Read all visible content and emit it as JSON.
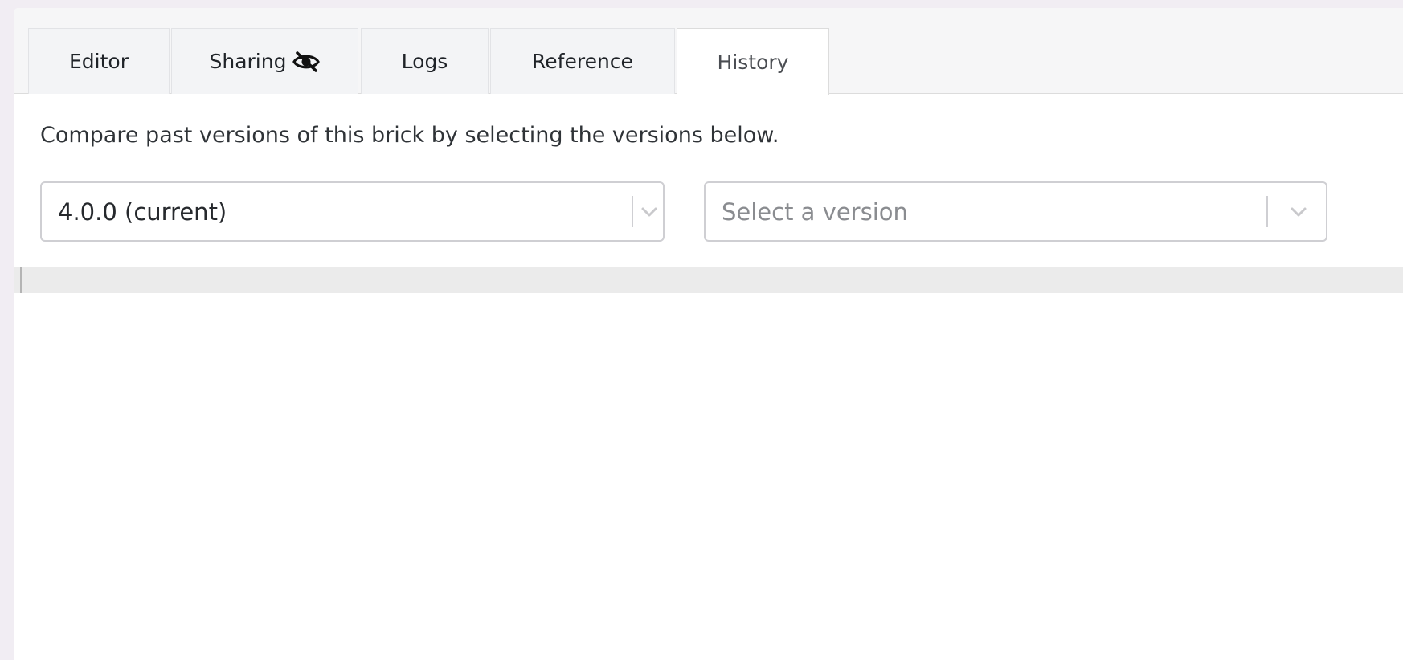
{
  "tabs": [
    {
      "label": "Editor",
      "active": false
    },
    {
      "label": "Sharing",
      "active": false,
      "icon": "eye-slash-icon"
    },
    {
      "label": "Logs",
      "active": false
    },
    {
      "label": "Reference",
      "active": false
    },
    {
      "label": "History",
      "active": true
    }
  ],
  "history": {
    "description": "Compare past versions of this brick by selecting the versions below.",
    "left_select": {
      "value": "4.0.0 (current)"
    },
    "right_select": {
      "placeholder": "Select a version"
    }
  },
  "colors": {
    "page_background": "#f1edf3",
    "active_tab_text": "#4a4d52",
    "placeholder_text": "#8a8c90"
  }
}
